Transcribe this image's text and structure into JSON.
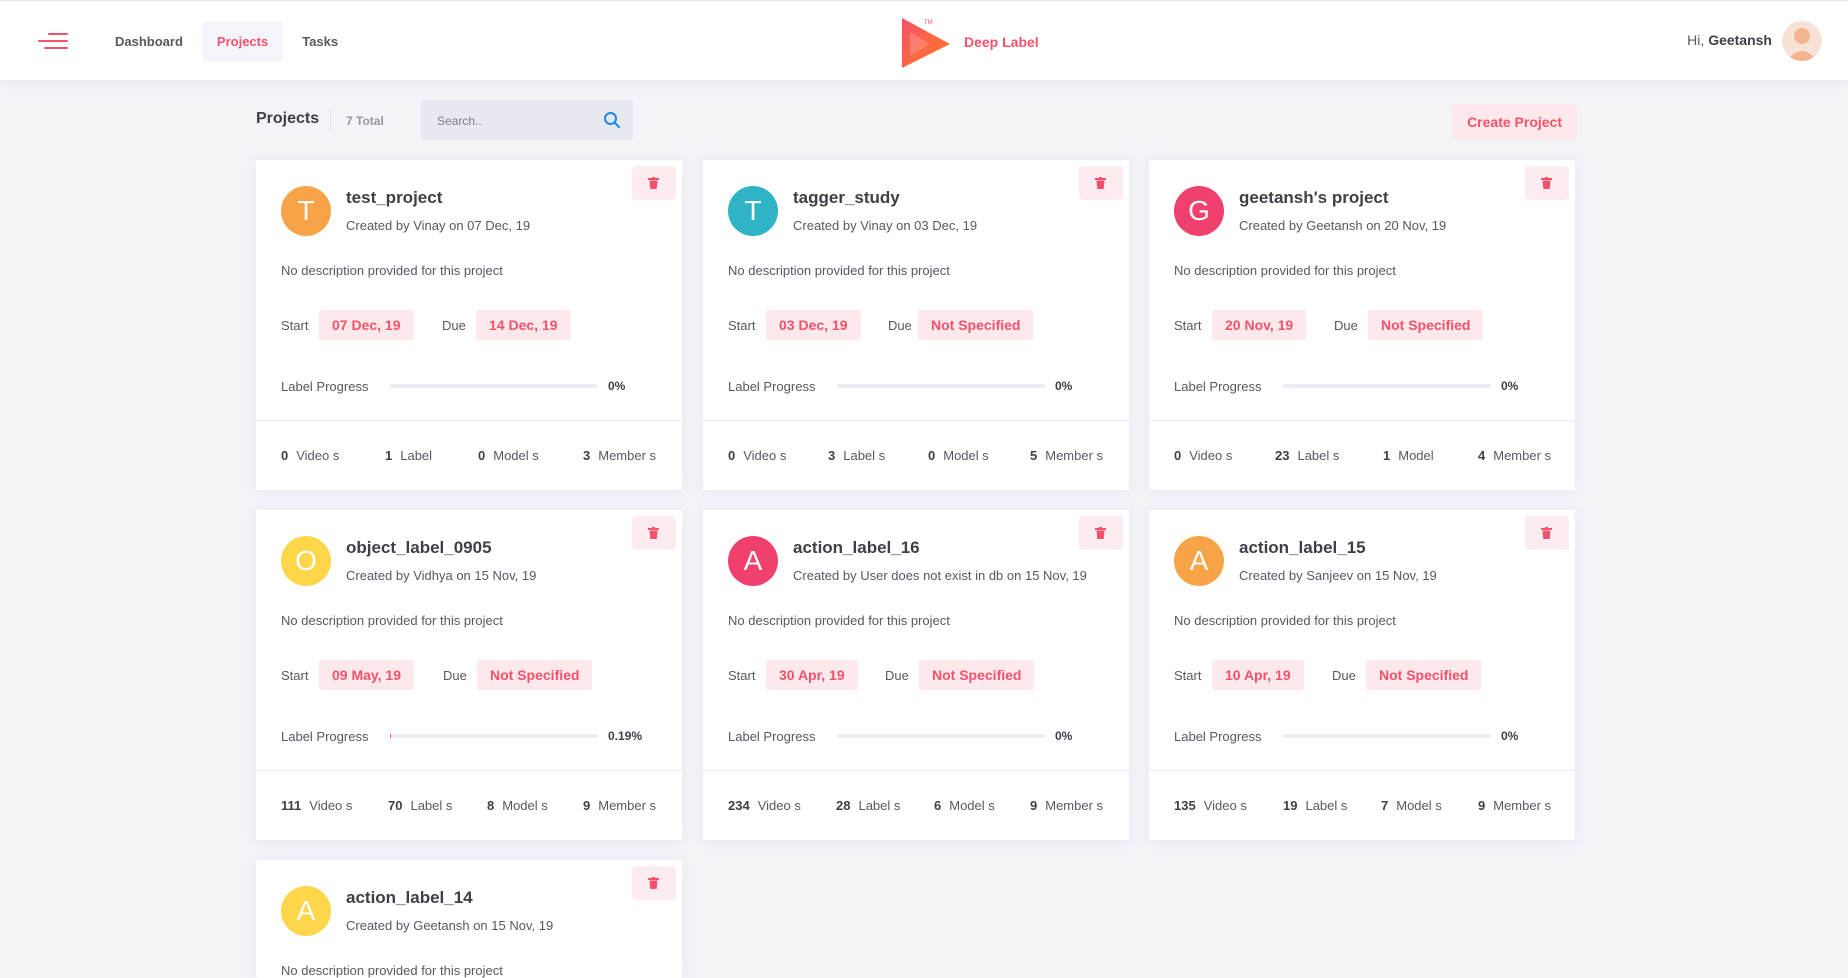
{
  "nav": {
    "items": [
      {
        "label": "Dashboard"
      },
      {
        "label": "Projects",
        "active": true
      },
      {
        "label": "Tasks"
      }
    ]
  },
  "brand": {
    "name": "Deep Label",
    "trademark": "TM"
  },
  "user": {
    "greeting": "Hi,",
    "name": "Geetansh"
  },
  "subheader": {
    "title": "Projects",
    "total": "7 Total",
    "search_placeholder": "Search..",
    "create_label": "Create Project"
  },
  "common": {
    "start_label": "Start",
    "due_label": "Due",
    "progress_label": "Label Progress",
    "description": "No description provided for this project"
  },
  "colors": {
    "accent": "#f4516c",
    "orange": "#f6a447",
    "teal": "#2fb4c6",
    "pink": "#f0416e",
    "yellow": "#ffd54a"
  },
  "projects": [
    {
      "letter": "T",
      "color": "#f6a447",
      "name": "test_project",
      "created": "Created by Vinay on 07 Dec, 19",
      "start": "07 Dec, 19",
      "due": "14 Dec, 19",
      "progress": "0%",
      "progress_value": 0,
      "videos": "0",
      "videos_label": "Video s",
      "labels": "1",
      "labels_label": "Label",
      "models": "0",
      "models_label": "Model s",
      "members": "3",
      "members_label": "Member s"
    },
    {
      "letter": "T",
      "color": "#2fb4c6",
      "name": "tagger_study",
      "created": "Created by Vinay on 03 Dec, 19",
      "start": "03 Dec, 19",
      "due": "Not Specified",
      "progress": "0%",
      "progress_value": 0,
      "videos": "0",
      "videos_label": "Video s",
      "labels": "3",
      "labels_label": "Label s",
      "models": "0",
      "models_label": "Model s",
      "members": "5",
      "members_label": "Member s"
    },
    {
      "letter": "G",
      "color": "#f0416e",
      "name": "geetansh's project",
      "created": "Created by Geetansh on 20 Nov, 19",
      "start": "20 Nov, 19",
      "due": "Not Specified",
      "progress": "0%",
      "progress_value": 0,
      "videos": "0",
      "videos_label": "Video s",
      "labels": "23",
      "labels_label": "Label s",
      "models": "1",
      "models_label": "Model",
      "members": "4",
      "members_label": "Member s"
    },
    {
      "letter": "O",
      "color": "#ffd54a",
      "name": "object_label_0905",
      "created": "Created by Vidhya on 15 Nov, 19",
      "start": "09 May, 19",
      "due": "Not Specified",
      "progress": "0.19%",
      "progress_value": 0.19,
      "videos": "111",
      "videos_label": "Video s",
      "labels": "70",
      "labels_label": "Label s",
      "models": "8",
      "models_label": "Model s",
      "members": "9",
      "members_label": "Member s"
    },
    {
      "letter": "A",
      "color": "#f0416e",
      "name": "action_label_16",
      "created": "Created by User does not exist in db on 15 Nov, 19",
      "start": "30 Apr, 19",
      "due": "Not Specified",
      "progress": "0%",
      "progress_value": 0,
      "videos": "234",
      "videos_label": "Video s",
      "labels": "28",
      "labels_label": "Label s",
      "models": "6",
      "models_label": "Model s",
      "members": "9",
      "members_label": "Member s"
    },
    {
      "letter": "A",
      "color": "#f6a447",
      "name": "action_label_15",
      "created": "Created by Sanjeev on 15 Nov, 19",
      "start": "10 Apr, 19",
      "due": "Not Specified",
      "progress": "0%",
      "progress_value": 0,
      "videos": "135",
      "videos_label": "Video s",
      "labels": "19",
      "labels_label": "Label s",
      "models": "7",
      "models_label": "Model s",
      "members": "9",
      "members_label": "Member s"
    },
    {
      "letter": "A",
      "color": "#ffd54a",
      "name": "action_label_14",
      "created": "Created by Geetansh on 15 Nov, 19"
    }
  ]
}
